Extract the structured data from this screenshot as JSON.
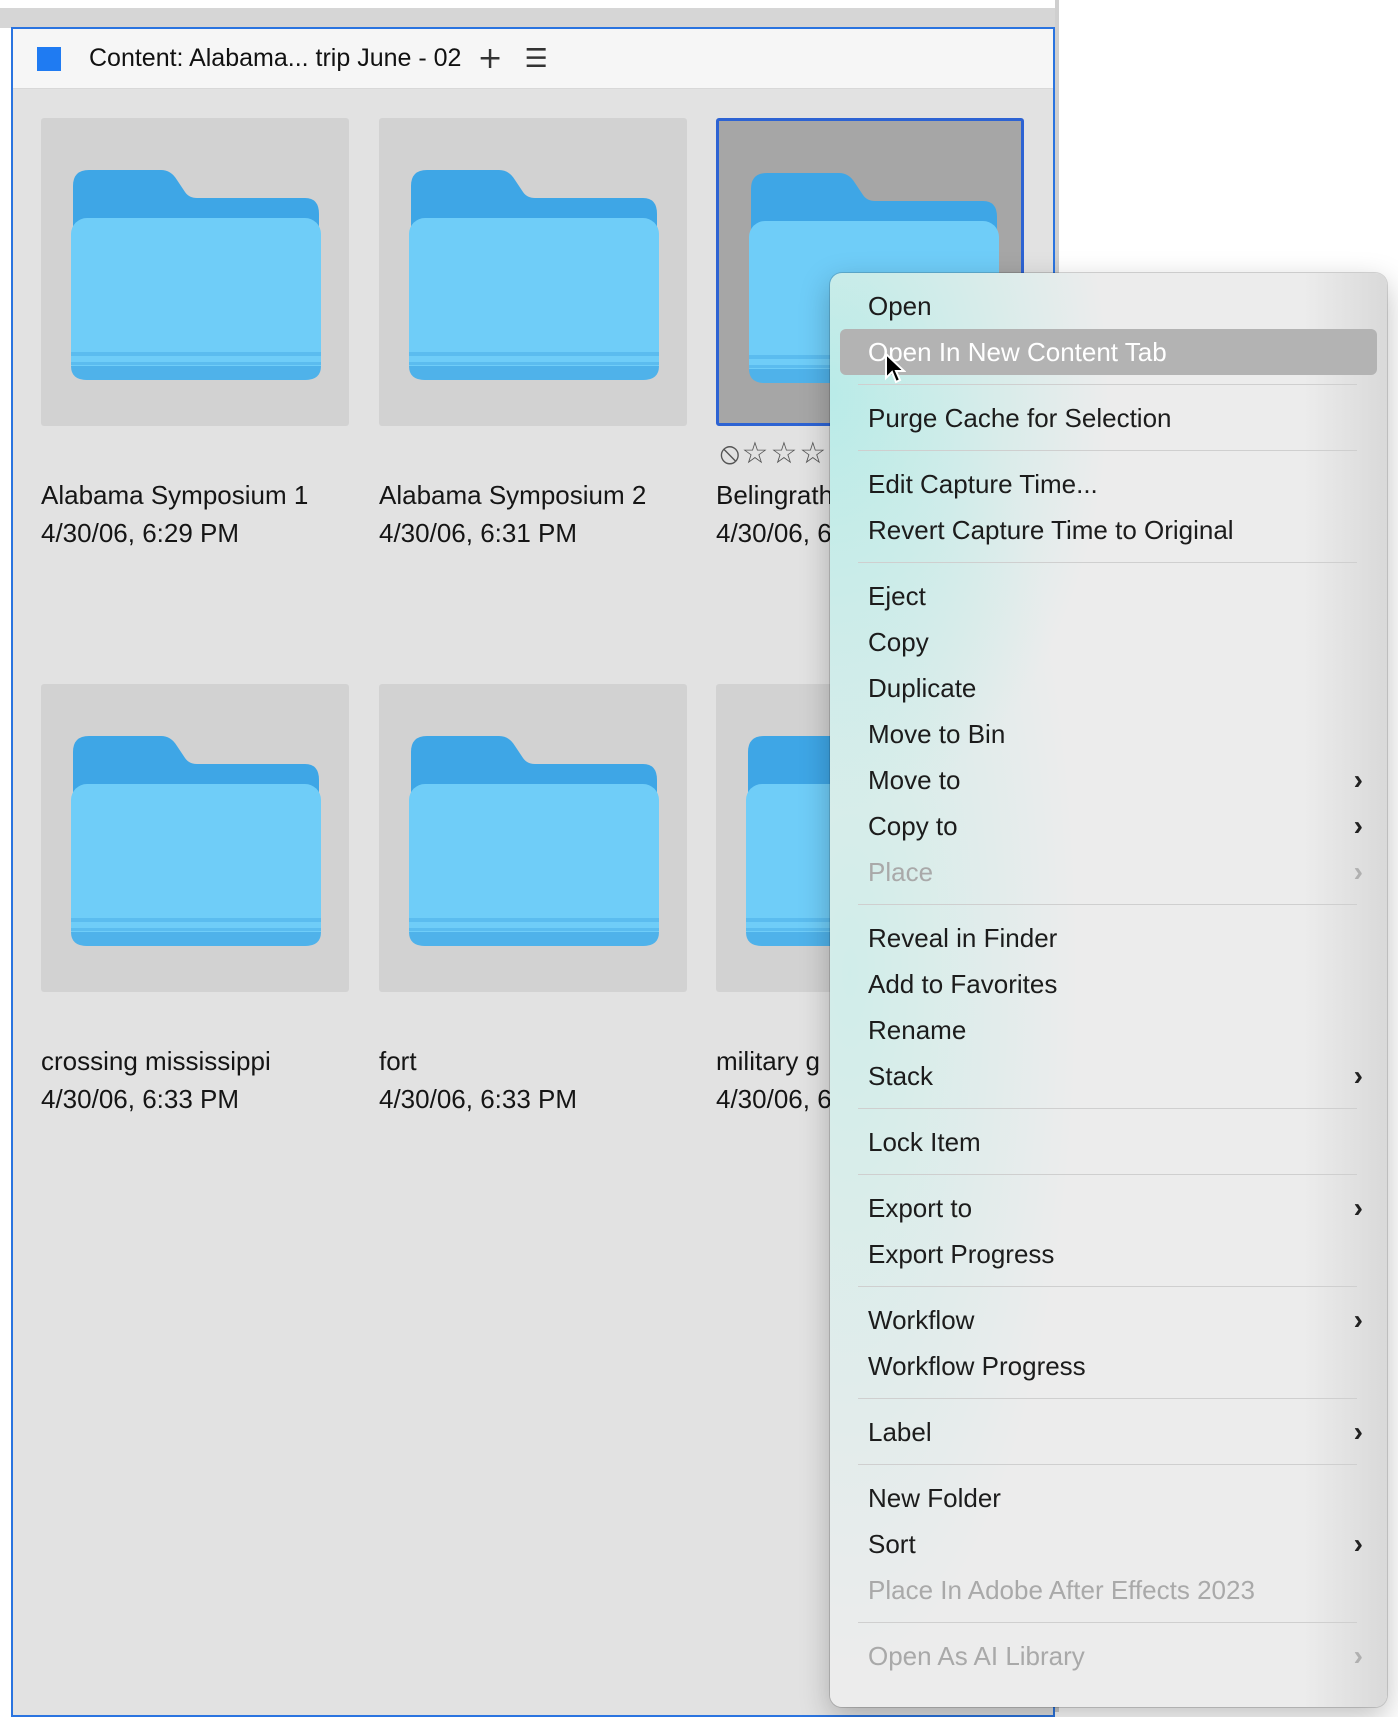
{
  "panel": {
    "title": "Content: Alabama... trip June - 02",
    "add_icon": "plus-icon",
    "menu_icon": "hamburger-icon"
  },
  "items": [
    {
      "name": "Alabama Symposium 1",
      "date": "4/30/06, 6:29 PM"
    },
    {
      "name": "Alabama Symposium 2",
      "date": "4/30/06, 6:31 PM"
    },
    {
      "name": "Belingrath",
      "date": "4/30/06, 6",
      "selected": true,
      "rating": "⦸☆☆☆"
    },
    {
      "name": "crossing mississippi",
      "date": "4/30/06, 6:33 PM"
    },
    {
      "name": "fort",
      "date": "4/30/06, 6:33 PM"
    },
    {
      "name": "military g",
      "date": "4/30/06, 6"
    }
  ],
  "menu": [
    {
      "label": "Open"
    },
    {
      "label": "Open In New Content Tab",
      "highlighted": true
    },
    {
      "sep": true
    },
    {
      "label": "Purge Cache for Selection"
    },
    {
      "sep": true
    },
    {
      "label": "Edit Capture Time..."
    },
    {
      "label": "Revert Capture Time to Original"
    },
    {
      "sep": true
    },
    {
      "label": "Eject"
    },
    {
      "label": "Copy"
    },
    {
      "label": "Duplicate"
    },
    {
      "label": "Move to Bin"
    },
    {
      "label": "Move to",
      "submenu": true
    },
    {
      "label": "Copy to",
      "submenu": true
    },
    {
      "label": "Place",
      "submenu": true,
      "disabled": true
    },
    {
      "sep": true
    },
    {
      "label": "Reveal in Finder"
    },
    {
      "label": "Add to Favorites"
    },
    {
      "label": "Rename"
    },
    {
      "label": "Stack",
      "submenu": true
    },
    {
      "sep": true
    },
    {
      "label": "Lock Item"
    },
    {
      "sep": true
    },
    {
      "label": "Export to",
      "submenu": true
    },
    {
      "label": "Export Progress"
    },
    {
      "sep": true
    },
    {
      "label": "Workflow",
      "submenu": true
    },
    {
      "label": "Workflow Progress"
    },
    {
      "sep": true
    },
    {
      "label": "Label",
      "submenu": true
    },
    {
      "sep": true
    },
    {
      "label": "New Folder"
    },
    {
      "label": "Sort",
      "submenu": true
    },
    {
      "label": "Place In Adobe After Effects 2023",
      "disabled": true
    },
    {
      "sep": true
    },
    {
      "label": "Open As AI Library",
      "submenu": true,
      "disabled": true
    }
  ],
  "colors": {
    "accent": "#2a74e0",
    "folder": "#6fcdf8",
    "folder_back": "#3ea6e6",
    "highlight": "#b3b3b3"
  }
}
